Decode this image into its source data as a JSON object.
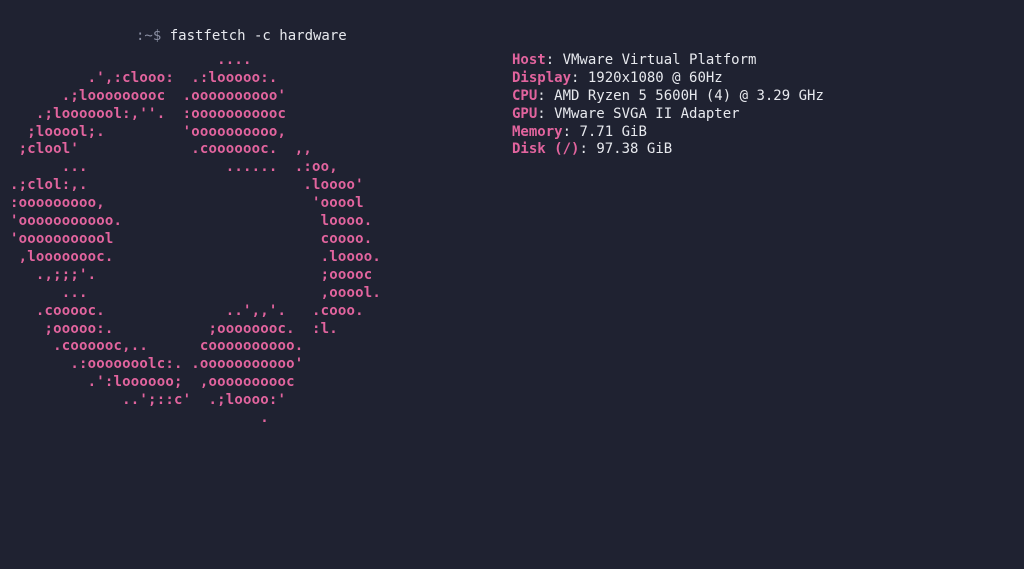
{
  "prompt": {
    "prefix": ":~$ ",
    "command": "fastfetch -c hardware"
  },
  "ascii": "                        ....\n         .',:clooo:  .:looooo:.\n      .;looooooooc  .oooooooooo'\n   .;looooool:,''.  :ooooooooooc\n  ;looool;.         'oooooooooo,\n ;clool'             .cooooooc.  ,,\n      ...                ......  .:oo,\n.;clol:,.                         .loooo'\n:ooooooooo,                        'ooool\n'ooooooooooo.                       loooo.\n'ooooooooool                        coooo.\n ,loooooooc.                        .loooo.\n   .,;;;'.                          ;ooooc\n      ...                           ,ooool.\n   .cooooc.              ..',,'.   .cooo.\n    ;ooooo:.           ;oooooooc.  :l.\n     .coooooc,..      coooooooooo.\n       .:ooooooolc:. .ooooooooooo'\n         .':loooooo;  ,oooooooooc\n             ..';::c'  .;loooo:'\n                             .",
  "info": {
    "host": {
      "label": "Host",
      "value": "VMware Virtual Platform"
    },
    "display": {
      "label": "Display",
      "value": "1920x1080 @ 60Hz"
    },
    "cpu": {
      "label": "CPU",
      "value": "AMD Ryzen 5 5600H (4) @ 3.29 GHz"
    },
    "gpu": {
      "label": "GPU",
      "value": "VMware SVGA II Adapter"
    },
    "memory": {
      "label": "Memory",
      "value": "7.71 GiB"
    },
    "disk": {
      "label": "Disk",
      "paren": "(/)",
      "value": "97.38 GiB"
    }
  }
}
